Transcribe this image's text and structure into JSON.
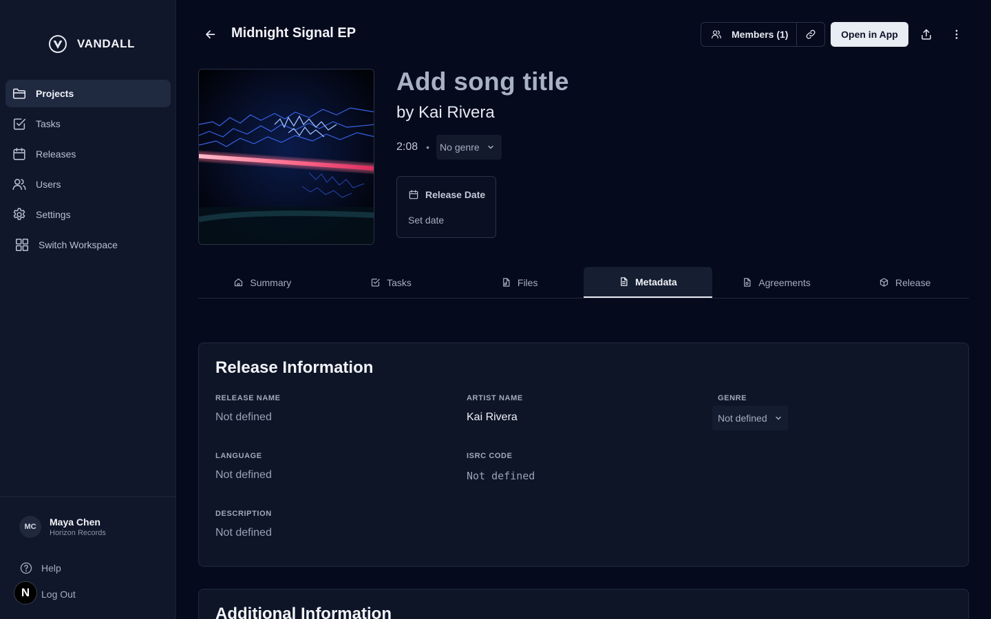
{
  "brand": {
    "name": "VANDALL"
  },
  "sidebar": {
    "items": [
      {
        "label": "Projects",
        "icon": "folder-icon",
        "active": true
      },
      {
        "label": "Tasks",
        "icon": "checkbox-icon"
      },
      {
        "label": "Releases",
        "icon": "calendar-icon"
      },
      {
        "label": "Users",
        "icon": "users-icon"
      },
      {
        "label": "Settings",
        "icon": "gear-icon"
      },
      {
        "label": "Switch Workspace",
        "icon": "grid-icon"
      }
    ],
    "user": {
      "initials": "MC",
      "name": "Maya Chen",
      "org": "Horizon Records"
    },
    "help_label": "Help",
    "logout_label": "Log Out",
    "badge_letter": "N"
  },
  "header": {
    "title": "Midnight Signal EP",
    "members_label": "Members (1)",
    "open_app_label": "Open in App"
  },
  "song": {
    "title": "Add song title",
    "artist": "by Kai Rivera",
    "duration": "2:08",
    "separator": "•",
    "genre": "No genre",
    "release_date_label": "Release Date",
    "release_date_value": "Set date"
  },
  "tabs": [
    {
      "label": "Summary",
      "icon": "home-icon"
    },
    {
      "label": "Tasks",
      "icon": "checkbox-icon"
    },
    {
      "label": "Files",
      "icon": "audio-file-icon"
    },
    {
      "label": "Metadata",
      "icon": "document-icon",
      "active": true
    },
    {
      "label": "Agreements",
      "icon": "contract-icon"
    },
    {
      "label": "Release",
      "icon": "package-icon"
    }
  ],
  "release_info": {
    "title": "Release Information",
    "release_name": {
      "label": "RELEASE NAME",
      "value": "Not defined"
    },
    "artist_name": {
      "label": "ARTIST NAME",
      "value": "Kai Rivera"
    },
    "genre": {
      "label": "GENRE",
      "value": "Not defined"
    },
    "language": {
      "label": "LANGUAGE",
      "value": "Not defined"
    },
    "isrc": {
      "label": "ISRC CODE",
      "value": "Not defined"
    },
    "description": {
      "label": "DESCRIPTION",
      "value": "Not defined"
    }
  },
  "additional_info": {
    "title": "Additional Information"
  },
  "colors": {
    "background": "#050a1c",
    "sidebar": "#10172a",
    "accent": "#e8ecf3"
  }
}
